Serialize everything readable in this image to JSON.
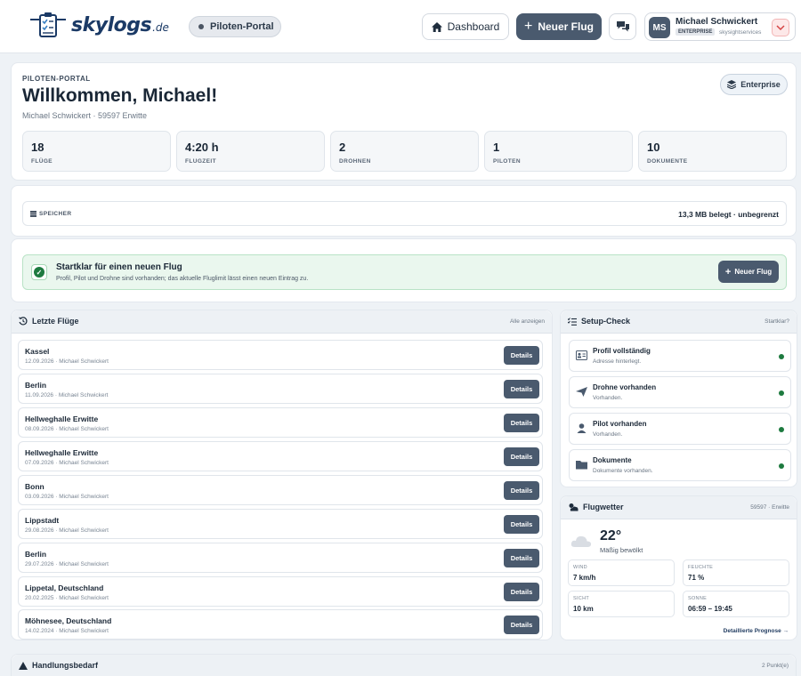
{
  "header": {
    "logo_text": "skylogs",
    "logo_tld": ".de",
    "portal_label": "Piloten-Portal",
    "dashboard_label": "Dashboard",
    "new_flight_label": "Neuer Flug",
    "user": {
      "initials": "MS",
      "name": "Michael Schwickert",
      "plan": "ENTERPRISE",
      "org": "skysightservices"
    }
  },
  "welcome": {
    "eyebrow": "PILOTEN-PORTAL",
    "title": "Willkommen, Michael!",
    "subtitle": "Michael Schwickert · 59597 Erwitte",
    "plan_label": "Enterprise",
    "stats": [
      {
        "value": "18",
        "label": "FLÜGE"
      },
      {
        "value": "4:20 h",
        "label": "FLUGZEIT"
      },
      {
        "value": "2",
        "label": "DROHNEN"
      },
      {
        "value": "1",
        "label": "PILOTEN"
      },
      {
        "value": "10",
        "label": "DOKUMENTE"
      }
    ]
  },
  "storage": {
    "label": "SPEICHER",
    "value": "13,3 MB belegt · unbegrenzt"
  },
  "ready": {
    "title": "Startklar für einen neuen Flug",
    "text": "Profil, Pilot und Drohne sind vorhanden; das aktuelle Fluglimit lässt einen neuen Eintrag zu.",
    "button_label": "Neuer Flug"
  },
  "flights": {
    "title": "Letzte Flüge",
    "show_all": "Alle anzeigen",
    "details_label": "Details",
    "items": [
      {
        "name": "Kassel",
        "meta": "12.09.2026 · Michael Schwickert"
      },
      {
        "name": "Berlin",
        "meta": "11.09.2026 · Michael Schwickert"
      },
      {
        "name": "Hellweghalle Erwitte",
        "meta": "08.09.2026 · Michael Schwickert"
      },
      {
        "name": "Hellweghalle Erwitte",
        "meta": "07.09.2026 · Michael Schwickert"
      },
      {
        "name": "Bonn",
        "meta": "03.09.2026 · Michael Schwickert"
      },
      {
        "name": "Lippstadt",
        "meta": "29.08.2026 · Michael Schwickert"
      },
      {
        "name": "Berlin",
        "meta": "29.07.2026 · Michael Schwickert"
      },
      {
        "name": "Lippetal, Deutschland",
        "meta": "20.02.2025 · Michael Schwickert"
      },
      {
        "name": "Möhnesee, Deutschland",
        "meta": "14.02.2024 · Michael Schwickert"
      }
    ]
  },
  "setup": {
    "title": "Setup-Check",
    "status": "Startklar?",
    "items": [
      {
        "title": "Profil vollständig",
        "text": "Adresse hinterlegt.",
        "icon": "id-card-icon"
      },
      {
        "title": "Drohne vorhanden",
        "text": "Vorhanden.",
        "icon": "paper-plane-icon"
      },
      {
        "title": "Pilot vorhanden",
        "text": "Vorhanden.",
        "icon": "person-icon"
      },
      {
        "title": "Dokumente",
        "text": "Dokumente vorhanden.",
        "icon": "folder-icon"
      }
    ]
  },
  "weather": {
    "title": "Flugwetter",
    "location": "59597 · Erwitte",
    "temp": "22°",
    "condition": "Mäßig bewölkt",
    "cells": [
      {
        "label": "WIND",
        "value": "7 km/h"
      },
      {
        "label": "FEUCHTE",
        "value": "71 %"
      },
      {
        "label": "SICHT",
        "value": "10 km"
      },
      {
        "label": "SONNE",
        "value": "06:59 – 19:45"
      }
    ],
    "forecast_link": "Detaillierte Prognose →"
  },
  "action": {
    "title": "Handlungsbedarf",
    "count": "2 Punkt(e)"
  },
  "colors": {
    "primary": "#4a5a6e",
    "success": "#1d7a3f",
    "brand": "#1b3a66"
  }
}
